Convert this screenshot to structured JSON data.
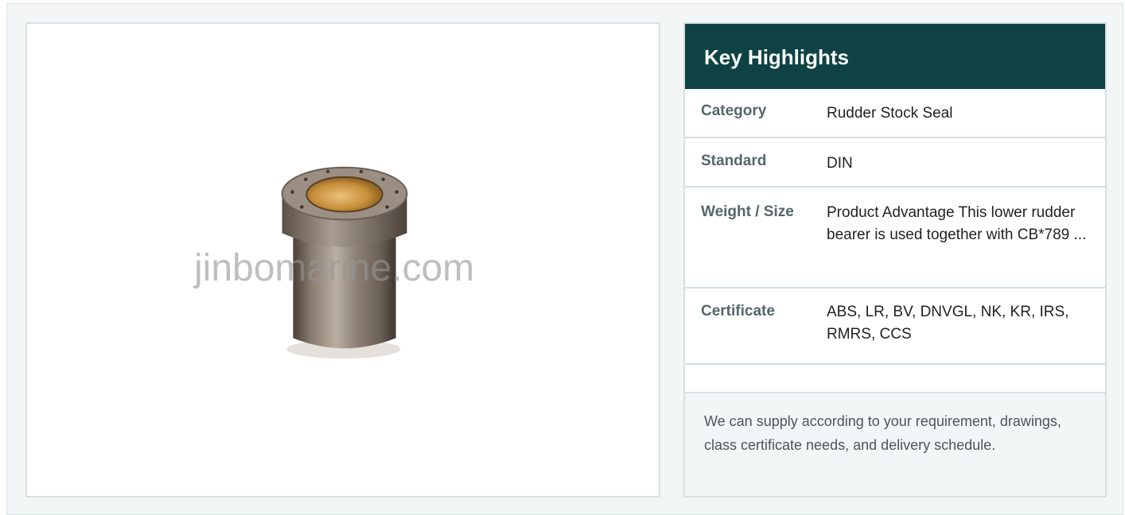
{
  "image_panel": {
    "watermark": "jinbomarine.com",
    "image_subject": "rudder-stock-seal-bushing"
  },
  "highlights": {
    "title": "Key Highlights",
    "rows": [
      {
        "key": "Category",
        "value": "Rudder Stock Seal"
      },
      {
        "key": "Standard",
        "value": "DIN"
      },
      {
        "key": "Weight / Size",
        "value": "Product Advantage This lower rudder bearer is used together with CB*789 ..."
      },
      {
        "key": "Certificate",
        "value": "ABS, LR, BV, DNVGL, NK, KR, IRS, RMRS, CCS"
      },
      {
        "key": "",
        "value": ""
      }
    ],
    "note": "We can supply according to your requirement, drawings, class certificate needs, and delivery schedule."
  },
  "colors": {
    "header_bg": "#0f4343",
    "page_bg": "#f3f6f6",
    "border": "#d6e0e0",
    "key_text": "#55666a"
  }
}
